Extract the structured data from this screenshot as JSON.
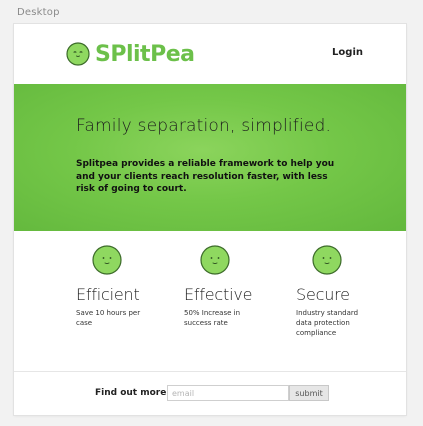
{
  "frame": {
    "label": "Desktop"
  },
  "header": {
    "logo_text": "SPlitPea",
    "login_label": "Login"
  },
  "hero": {
    "title": "Family separation, simplified.",
    "body": "Splitpea provides a reliable framework to help you and your clients reach resolution faster, with less risk of going to court."
  },
  "features": [
    {
      "icon": "pea-face-icon",
      "title": "Efficient",
      "text": "Save 10 hours per case"
    },
    {
      "icon": "pea-face-icon",
      "title": "Effective",
      "text": "50% Increase in success rate"
    },
    {
      "icon": "pea-face-icon",
      "title": "Secure",
      "text": "Industry standard data protection compliance"
    }
  ],
  "footer": {
    "find_label": "Find out more:",
    "email_placeholder": "email",
    "submit_label": "submit"
  },
  "colors": {
    "brand_green": "#6cc04a",
    "hero_green": "#74c748",
    "pea_fill": "#8fd860",
    "pea_outline": "#3c6b2a"
  }
}
